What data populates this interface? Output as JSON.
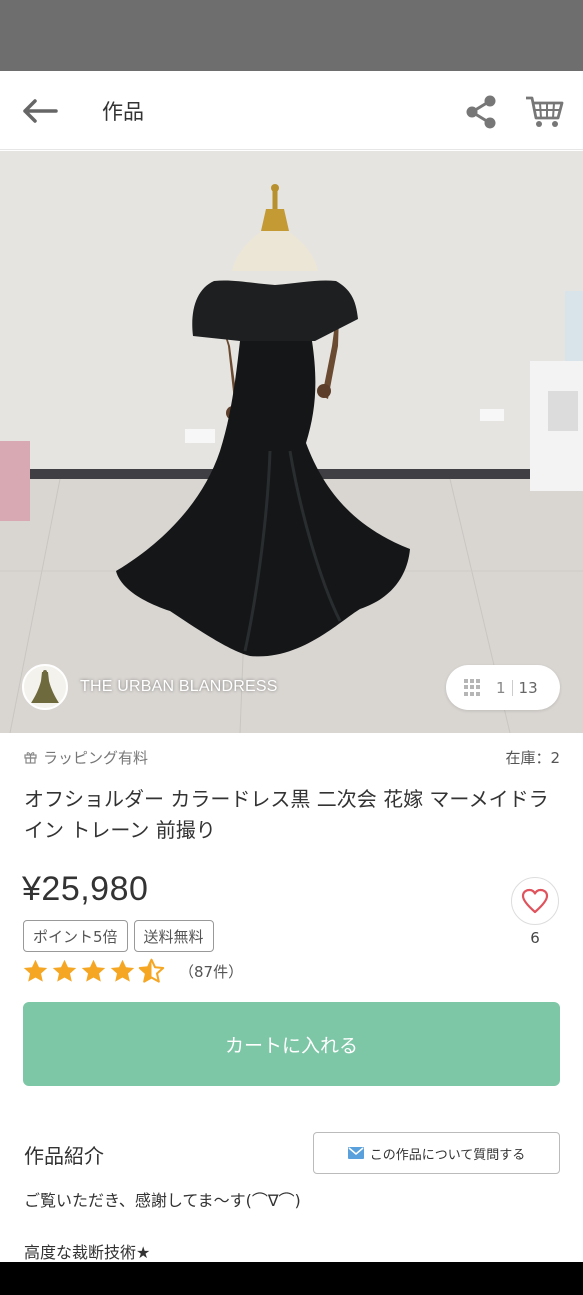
{
  "header": {
    "title": "作品",
    "back_icon": "arrow-left-icon",
    "share_icon": "share-icon",
    "cart_icon": "cart-icon"
  },
  "gallery": {
    "shop_name": "THE URBAN BLANDRESS",
    "current": "1",
    "total": "13"
  },
  "meta": {
    "wrapping": "ラッピング有料",
    "stock": "在庫：2"
  },
  "product": {
    "title": "オフショルダー カラードレス黒 二次会 花嫁 マーメイドライン トレーン 前撮り",
    "price": "¥25,980",
    "tags": [
      "ポイント5倍",
      "送料無料"
    ],
    "rating": 4.5,
    "reviews": "（87件）",
    "favorites": "6"
  },
  "actions": {
    "add_to_cart": "カートに入れる",
    "ask_question": "この作品について質問する"
  },
  "intro": {
    "heading": "作品紹介",
    "line1": "ご覧いただき、感謝してま～す(⌒∇⌒)",
    "line2": "高度な裁断技術★"
  },
  "colors": {
    "accent": "#7dc6a6",
    "star": "#f5a623",
    "heart": "#e0525c"
  }
}
